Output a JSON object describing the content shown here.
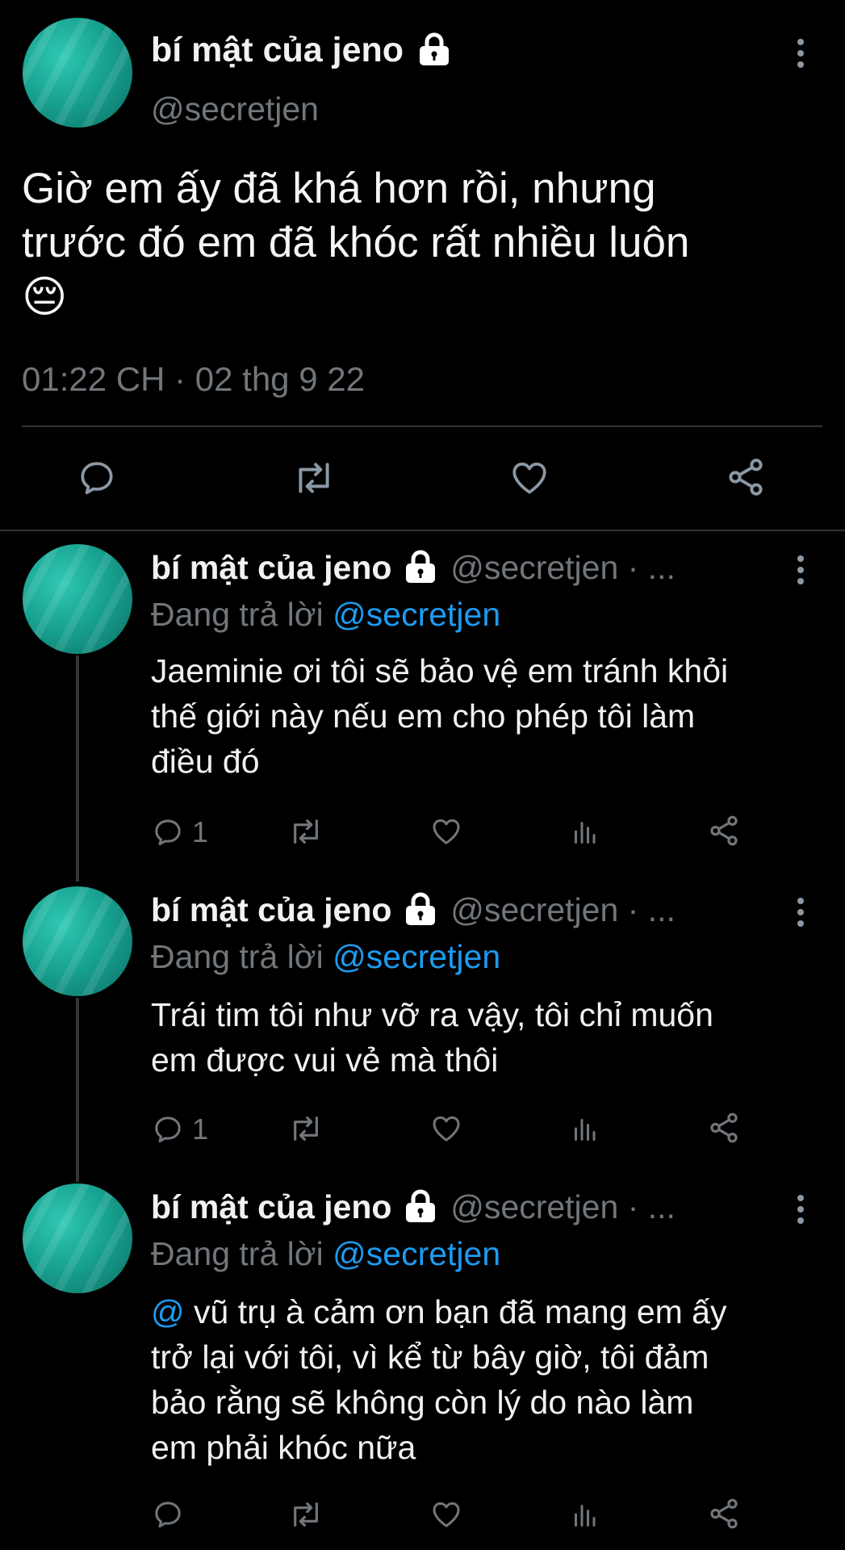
{
  "main_tweet": {
    "display_name": "bí mật của jeno",
    "handle": "@secretjen",
    "text_line1": "Giờ em ấy đã khá hơn rồi, nhưng",
    "text_line2": "trước đó em đã khóc rất nhiều luôn",
    "emoji": "😔",
    "timestamp": "01:22 CH · 02 thg 9 22",
    "icons": [
      "reply-icon",
      "retweet-icon",
      "like-icon",
      "share-icon"
    ]
  },
  "replies": [
    {
      "display_name": "bí mật của jeno",
      "handle_meta": "@secretjen · ...",
      "replying_prefix": "Đang trả lời",
      "replying_to": "@secretjen",
      "lines": [
        "Jaeminie ơi tôi sẽ bảo vệ em tránh khỏi",
        "thế giới này nếu em cho phép tôi làm",
        "điều đó"
      ],
      "reply_count": "1"
    },
    {
      "display_name": "bí mật của jeno",
      "handle_meta": "@secretjen · ...",
      "replying_prefix": "Đang trả lời",
      "replying_to": "@secretjen",
      "lines": [
        "Trái tim tôi như vỡ ra vậy, tôi chỉ muốn",
        "em được vui vẻ mà thôi"
      ],
      "reply_count": "1"
    },
    {
      "display_name": "bí mật của jeno",
      "handle_meta": "@secretjen · ...",
      "replying_prefix": "Đang trả lời",
      "replying_to": "@secretjen",
      "mention": "@",
      "first_line_rest": "vũ trụ à cảm ơn bạn đã mang em ấy",
      "lines": [
        "trở lại với tôi, vì kể từ bây giờ, tôi đảm",
        "bảo rằng sẽ không còn lý do nào làm",
        "em phải khóc nữa"
      ],
      "reply_count": ""
    }
  ],
  "colors": {
    "background": "#000000",
    "link": "#1d9bf0",
    "muted": "#71767b",
    "divider": "#2f3336"
  }
}
